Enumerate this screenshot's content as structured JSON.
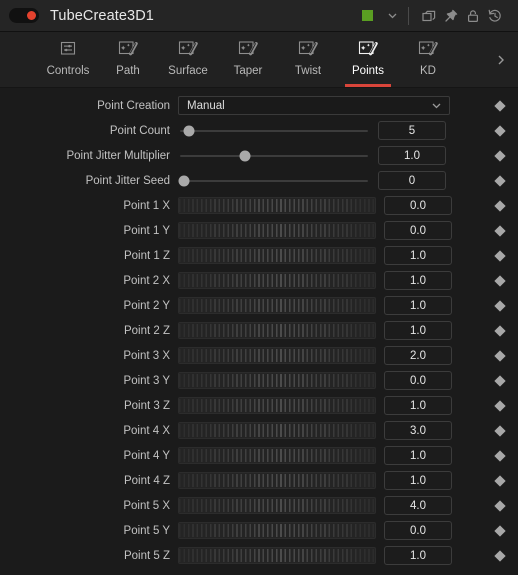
{
  "titlebar": {
    "node_name": "TubeCreate3D1",
    "enable_toggle": "node-enable-toggle",
    "swatch_color": "#5a9e22",
    "icons": [
      {
        "name": "copy-icon",
        "label": "Duplicate"
      },
      {
        "name": "pin-icon",
        "label": "Pin"
      },
      {
        "name": "lock-icon",
        "label": "Lock"
      },
      {
        "name": "reset-icon",
        "label": "Reset"
      }
    ],
    "chevron_label": "Color select"
  },
  "tabs": [
    {
      "label": "Controls",
      "icon": "sliders-icon",
      "active": false
    },
    {
      "label": "Path",
      "icon": "magic-wand-icon",
      "active": false
    },
    {
      "label": "Surface",
      "icon": "magic-wand-icon",
      "active": false
    },
    {
      "label": "Taper",
      "icon": "magic-wand-icon",
      "active": false
    },
    {
      "label": "Twist",
      "icon": "magic-wand-icon",
      "active": false
    },
    {
      "label": "Points",
      "icon": "magic-wand-icon",
      "active": true
    },
    {
      "label": "KD",
      "icon": "magic-wand-icon",
      "active": false
    }
  ],
  "tab_scroll_icon": "chevron-right-icon",
  "active_tab_color": "#d9453a",
  "params": [
    {
      "label": "Point Creation",
      "type": "dropdown",
      "value": "Manual",
      "options": [
        "Manual"
      ]
    },
    {
      "label": "Point Count",
      "type": "slider",
      "value": "5",
      "knob_pct": 4
    },
    {
      "label": "Point Jitter Multiplier",
      "type": "slider",
      "value": "1.0",
      "knob_pct": 34
    },
    {
      "label": "Point Jitter Seed",
      "type": "slider",
      "value": "0",
      "knob_pct": 1
    },
    {
      "label": "Point 1 X",
      "type": "thumbwheel",
      "value": "0.0"
    },
    {
      "label": "Point 1 Y",
      "type": "thumbwheel",
      "value": "0.0"
    },
    {
      "label": "Point 1 Z",
      "type": "thumbwheel",
      "value": "1.0"
    },
    {
      "label": "Point 2 X",
      "type": "thumbwheel",
      "value": "1.0"
    },
    {
      "label": "Point 2 Y",
      "type": "thumbwheel",
      "value": "1.0"
    },
    {
      "label": "Point 2 Z",
      "type": "thumbwheel",
      "value": "1.0"
    },
    {
      "label": "Point 3 X",
      "type": "thumbwheel",
      "value": "2.0"
    },
    {
      "label": "Point 3 Y",
      "type": "thumbwheel",
      "value": "0.0"
    },
    {
      "label": "Point 3 Z",
      "type": "thumbwheel",
      "value": "1.0"
    },
    {
      "label": "Point 4 X",
      "type": "thumbwheel",
      "value": "3.0"
    },
    {
      "label": "Point 4 Y",
      "type": "thumbwheel",
      "value": "1.0"
    },
    {
      "label": "Point 4 Z",
      "type": "thumbwheel",
      "value": "1.0"
    },
    {
      "label": "Point 5 X",
      "type": "thumbwheel",
      "value": "4.0"
    },
    {
      "label": "Point 5 Y",
      "type": "thumbwheel",
      "value": "0.0"
    },
    {
      "label": "Point 5 Z",
      "type": "thumbwheel",
      "value": "1.0"
    }
  ]
}
